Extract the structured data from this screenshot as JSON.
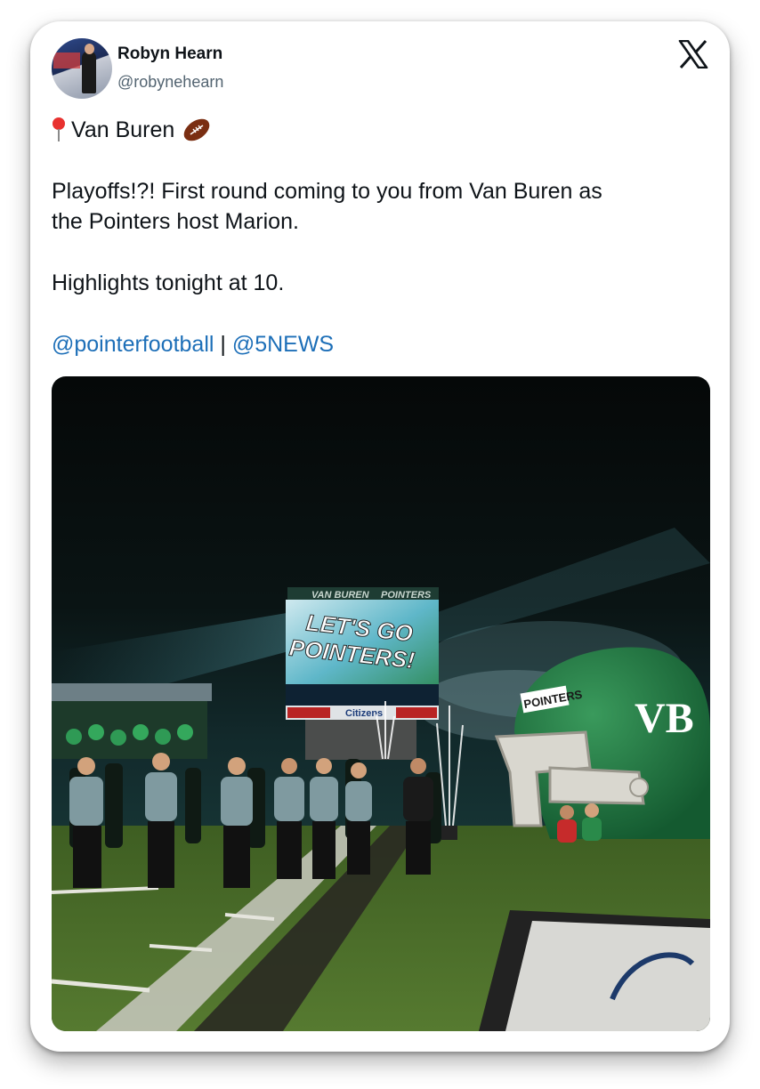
{
  "author": {
    "name": "Robyn Hearn",
    "handle": "@robynehearn"
  },
  "icons": {
    "close": "x-logo-icon",
    "location": "round-pushpin-icon",
    "sport": "american-football-icon"
  },
  "tweet": {
    "location_line": "Van Buren",
    "line1": "Playoffs!?! First round coming to you from Van Buren as",
    "line2": "the Pointers host Marion.",
    "line3": "Highlights tonight at 10.",
    "mention1": "@pointerfootball",
    "separator": " | ",
    "mention2": "@5NEWS"
  },
  "photo": {
    "scoreboard_header_left": "VAN BUREN",
    "scoreboard_header_right": "POINTERS",
    "screen_line1": "LET'S GO",
    "screen_line2": "POINTERS!",
    "sponsor_center": "Citizens",
    "helmet_label": "POINTERS",
    "helmet_logo": "VB"
  },
  "colors": {
    "link": "#1d6fb8",
    "turf": "#4a6b2a",
    "team_green": "#1f7a45"
  }
}
